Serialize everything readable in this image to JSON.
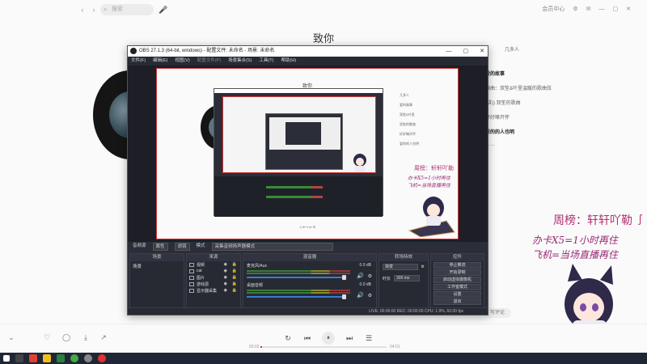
{
  "music_app": {
    "top": {
      "back_icon": "chevron-left",
      "forward_icon": "chevron-right",
      "search_placeholder": "搜索",
      "mic_icon": "microphone",
      "right_label": "会员中心",
      "icons": [
        "gear-icon",
        "mail-icon",
        "minimize-icon",
        "maximize-icon",
        "close-icon"
      ]
    },
    "song_title": "致你",
    "lyrics_header": "几多人",
    "lyrics": [
      {
        "text": "爱的故事",
        "bold": true
      },
      {
        "text": "编曲：双笙&叶里温暖的歌曲弦",
        "bold": false
      },
      {
        "text": "(讲)) 双笙的歌曲",
        "bold": false
      },
      {
        "text": "好好嘛开怀",
        "bold": false
      },
      {
        "text": "爱的的人也明",
        "bold": true
      },
      {
        "text": "……",
        "bold": false
      }
    ],
    "comment_button": "写评论",
    "player": {
      "time_current": "00:02",
      "time_total": "04:01",
      "progress": 0.01
    }
  },
  "stream_overlay": {
    "line1": "周榜：轩轩吖勒",
    "line2": "办卡X5=1小时再住",
    "line3": "飞机=当场直播再住"
  },
  "obs": {
    "title": "OBS 27.1.3 (64-bit, windows) - 配置文件: 未命名 - 场景: 未命名",
    "menu": [
      {
        "label": "文件(F)",
        "dim": false
      },
      {
        "label": "编辑(E)",
        "dim": false
      },
      {
        "label": "视图(V)",
        "dim": false
      },
      {
        "label": "配置文件(P)",
        "dim": true
      },
      {
        "label": "场景集合(S)",
        "dim": false
      },
      {
        "label": "工具(T)",
        "dim": false
      },
      {
        "label": "帮助(H)",
        "dim": false
      }
    ],
    "scene_bar": {
      "label": "音频源",
      "props": "属性",
      "filters": "滤镜",
      "mode": "模式",
      "mode_value": "采集音频扬声器模式"
    },
    "docks": {
      "scenes_title": "场景",
      "scenes": [
        "场景"
      ],
      "sources_title": "来源",
      "sources": [
        "视频",
        "cat",
        "图片",
        "游戏源",
        "显示器采集"
      ],
      "mixer_title": "混音器",
      "tracks": [
        {
          "name": "麦克风/Aux",
          "db": "0.0 dB"
        },
        {
          "name": "桌面音频",
          "db": "0.0 dB"
        }
      ],
      "transitions_title": "转场特效",
      "transition_value": "渐变",
      "duration_label": "时长",
      "duration_value": "300 ms",
      "controls_title": "控件",
      "controls": [
        "停止推流",
        "开始录制",
        "启动虚拟摄像机",
        "工作室模式",
        "设置",
        "退出"
      ]
    },
    "status": "LIVE: 00:00:00   REC: 00:00:00   CPU: 1.9%, 60.00 fps",
    "preview": {
      "title": "致你",
      "lyrics": [
        "几多人",
        "爱的故事",
        "双笙&叶里",
        "双笙的歌曲",
        "好好嘛开怀",
        "爱的的人也明"
      ],
      "overlay1": "周榜：轩轩吖勒",
      "overlay2": "办卡X5=1小时再住",
      "overlay3": "飞机=当场直播再住",
      "player_text": "◁   ⏮   ⏸   ⏭   ☰"
    }
  }
}
